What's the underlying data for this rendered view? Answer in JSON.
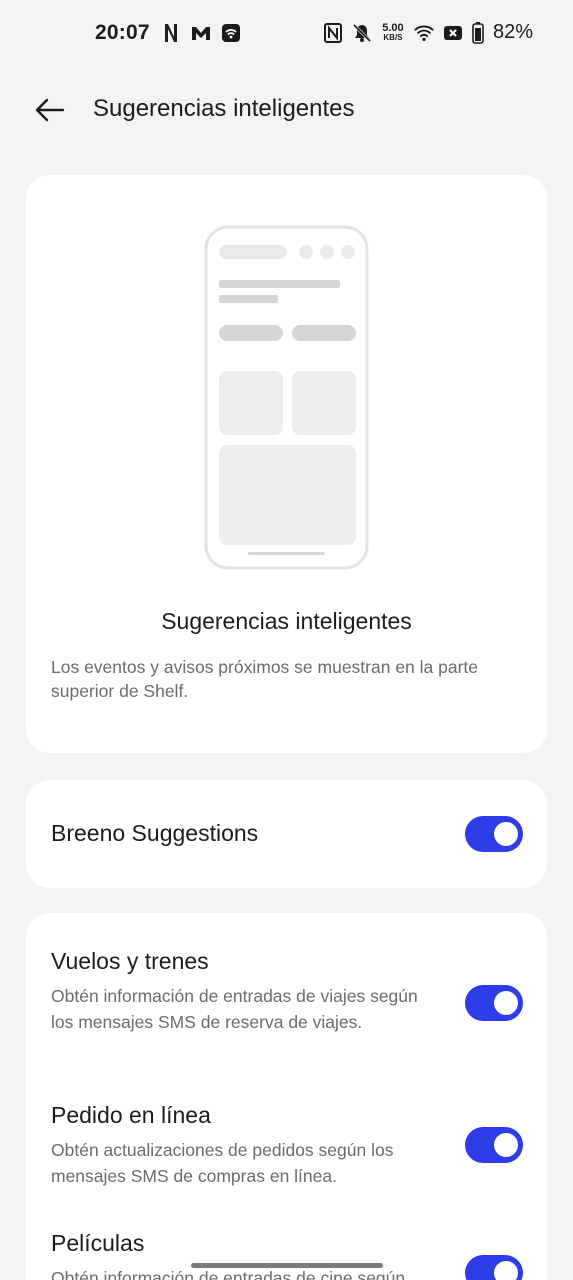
{
  "status_bar": {
    "time": "20:07",
    "left_icons": [
      "netflix-icon",
      "gmail-icon",
      "wifi-app-icon"
    ],
    "right_icons": [
      "nfc-icon",
      "mute-icon",
      "wifi-icon",
      "sim-off-icon",
      "battery-icon"
    ],
    "speed_value": "5.00",
    "speed_unit": "KB/S",
    "battery_pct": "82%"
  },
  "header": {
    "title": "Sugerencias inteligentes"
  },
  "hero": {
    "title": "Sugerencias inteligentes",
    "description": "Los eventos y avisos próximos se muestran en la parte superior de Shelf."
  },
  "breeno": {
    "label": "Breeno Suggestions",
    "enabled": true
  },
  "list": [
    {
      "title": "Vuelos y trenes",
      "description": "Obtén información de entradas de viajes según los mensajes SMS de reserva de viajes.",
      "enabled": true
    },
    {
      "title": "Pedido en línea",
      "description": "Obtén actualizaciones de pedidos según los mensajes SMS de compras en línea.",
      "enabled": true
    },
    {
      "title": "Películas",
      "description": "Obtén información de entradas de cine según",
      "enabled": true
    }
  ],
  "colors": {
    "accent": "#2c3de8",
    "background": "#f3f3f4",
    "card": "#ffffff",
    "secondary_text": "#6b6b70"
  }
}
